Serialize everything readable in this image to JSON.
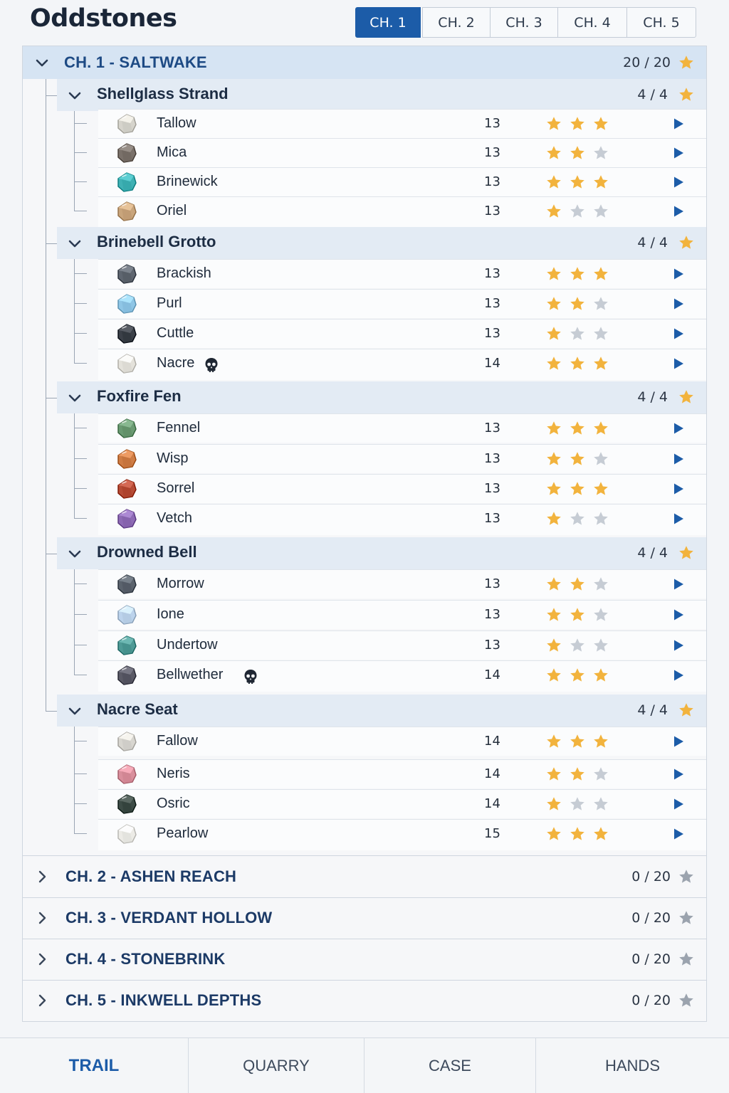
{
  "app": {
    "title": "Oddstones"
  },
  "chapter_tabs": [
    "CH. 1",
    "CH. 2",
    "CH. 3",
    "CH. 4",
    "CH. 5"
  ],
  "active_tab": 0,
  "colors": {
    "accent": "#1c5ca8",
    "star_gold": "#f2b33d",
    "star_grey": "#c6ccd4",
    "play": "#1c5ca8"
  },
  "open_chapter": {
    "title": "CH. 1 - SALTWAKE",
    "count": "20 / 20",
    "sections": [
      {
        "title": "Shellglass Strand",
        "count": "4 / 4",
        "stones": [
          {
            "name": "Tallow",
            "value": "13",
            "stars": 3,
            "color": "#d6d4cc",
            "skull": false
          },
          {
            "name": "Mica",
            "value": "13",
            "stars": 2,
            "color": "#7a716a",
            "skull": false
          },
          {
            "name": "Brinewick",
            "value": "13",
            "stars": 3,
            "color": "#3fb1b4",
            "skull": false
          },
          {
            "name": "Oriel",
            "value": "13",
            "stars": 1,
            "color": "#c9a57c",
            "skull": false
          }
        ]
      },
      {
        "title": "Brinebell Grotto",
        "count": "4 / 4",
        "stones": [
          {
            "name": "Brackish",
            "value": "13",
            "stars": 3,
            "color": "#5f6670",
            "skull": false
          },
          {
            "name": "Purl",
            "value": "13",
            "stars": 2,
            "color": "#8fc6e6",
            "skull": false
          },
          {
            "name": "Cuttle",
            "value": "13",
            "stars": 1,
            "color": "#3b4048",
            "skull": false
          },
          {
            "name": "Nacre",
            "value": "14",
            "stars": 3,
            "color": "#e4e2db",
            "skull": true
          }
        ]
      },
      {
        "title": "Foxfire Fen",
        "count": "4 / 4",
        "stones": [
          {
            "name": "Fennel",
            "value": "13",
            "stars": 3,
            "color": "#6a9a72",
            "skull": false
          },
          {
            "name": "Wisp",
            "value": "13",
            "stars": 2,
            "color": "#cf7d45",
            "skull": false
          },
          {
            "name": "Sorrel",
            "value": "13",
            "stars": 3,
            "color": "#b64c36",
            "skull": false
          },
          {
            "name": "Vetch",
            "value": "13",
            "stars": 1,
            "color": "#8e6bb5",
            "skull": false
          }
        ]
      },
      {
        "title": "Drowned Bell",
        "count": "4 / 4",
        "stones": [
          {
            "name": "Morrow",
            "value": "13",
            "stars": 2,
            "color": "#5b636d",
            "skull": false
          },
          {
            "name": "Ione",
            "value": "13",
            "stars": 2,
            "color": "#bcd3ec",
            "skull": false
          },
          {
            "name": "Undertow",
            "value": "13",
            "stars": 1,
            "color": "#4f9a96",
            "skull": false
          },
          {
            "name": "Bellwether",
            "value": "14",
            "stars": 3,
            "color": "#5a5a66",
            "skull": true
          }
        ]
      },
      {
        "title": "Nacre Seat",
        "count": "4 / 4",
        "stones": [
          {
            "name": "Fallow",
            "value": "14",
            "stars": 3,
            "color": "#d8d6d0",
            "skull": false
          },
          {
            "name": "Neris",
            "value": "14",
            "stars": 2,
            "color": "#d98f9c",
            "skull": false
          },
          {
            "name": "Osric",
            "value": "14",
            "stars": 1,
            "color": "#3d4c46",
            "skull": false
          },
          {
            "name": "Pearlow",
            "value": "15",
            "stars": 3,
            "color": "#ecebe6",
            "skull": false
          }
        ]
      }
    ]
  },
  "closed_chapters": [
    {
      "title": "CH. 2 - ASHEN REACH",
      "count": "0 / 20"
    },
    {
      "title": "CH. 3 - VERDANT HOLLOW",
      "count": "0 / 20"
    },
    {
      "title": "CH. 4 - STONEBRINK",
      "count": "0 / 20"
    },
    {
      "title": "CH. 5 - INKWELL DEPTHS",
      "count": "0 / 20"
    }
  ],
  "bottom_nav": [
    "TRAIL",
    "QUARRY",
    "CASE",
    "HANDS"
  ],
  "active_nav": 0
}
